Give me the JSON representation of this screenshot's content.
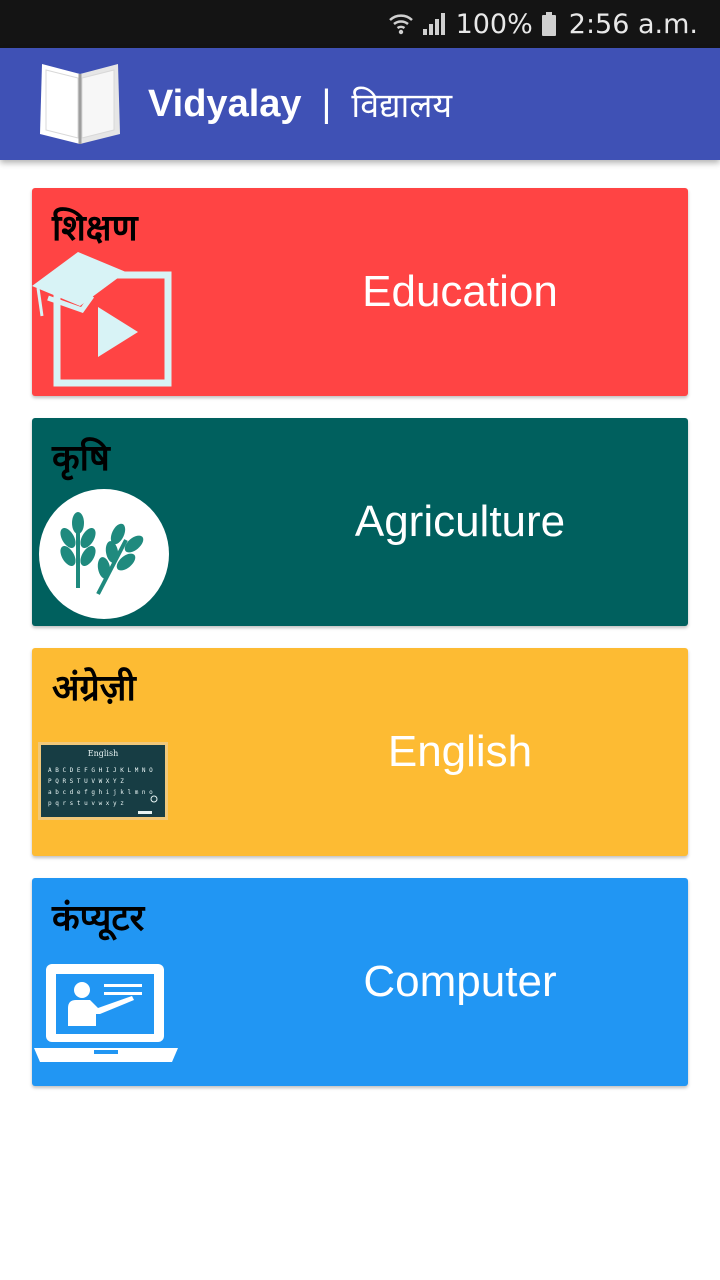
{
  "status_bar": {
    "battery_percent": "100%",
    "time": "2:56 a.m.",
    "icons": [
      "wifi-icon",
      "signal-icon",
      "battery-icon"
    ]
  },
  "app_bar": {
    "title_en": "Vidyalay",
    "separator": "|",
    "title_hi": "विद्यालय",
    "logo_icon": "open-book-icon",
    "color": "#3f51b5"
  },
  "cards": [
    {
      "hindi": "शिक्षण",
      "label": "Education",
      "color": "#ff4444",
      "icon": "graduation-video-icon"
    },
    {
      "hindi": "कृषि",
      "label": "Agriculture",
      "color": "#00605e",
      "icon": "wheat-icon"
    },
    {
      "hindi": "अंग्रेज़ी",
      "label": "English",
      "color": "#fdbb33",
      "icon": "chalkboard-icon"
    },
    {
      "hindi": "कंप्यूटर",
      "label": "Computer",
      "color": "#2196f3",
      "icon": "laptop-teacher-icon"
    }
  ],
  "chalkboard": {
    "title": "English",
    "line1": "A B C D E F G H I J K L M N O",
    "line2": "P Q R S T U V W X Y Z",
    "line3": "a b c d e f g h i j k l m n o",
    "line4": "p q r s t u v w x y z"
  }
}
